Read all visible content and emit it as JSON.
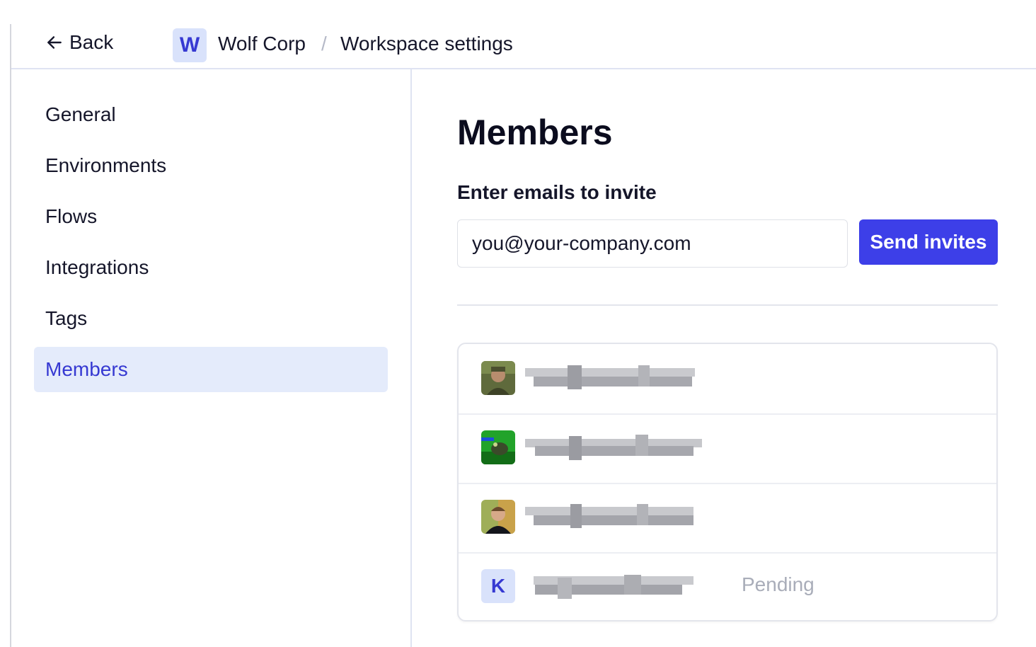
{
  "header": {
    "back_label": "Back",
    "workspace_initial": "W",
    "workspace_name": "Wolf Corp",
    "separator": "/",
    "page_name": "Workspace settings"
  },
  "sidebar": {
    "items": [
      {
        "label": "General"
      },
      {
        "label": "Environments"
      },
      {
        "label": "Flows"
      },
      {
        "label": "Integrations"
      },
      {
        "label": "Tags"
      },
      {
        "label": "Members",
        "active": true
      }
    ]
  },
  "main": {
    "title": "Members",
    "invite_label": "Enter emails to invite",
    "email_value": "you@your-company.com",
    "send_button": "Send invites"
  },
  "members": [
    {
      "avatar": "photo-avatar"
    },
    {
      "avatar": "photo-avatar"
    },
    {
      "avatar": "photo-avatar"
    },
    {
      "avatar_initial": "K",
      "status": "Pending"
    }
  ],
  "colors": {
    "accent": "#3d3fe8",
    "active_bg": "#e4ebfb",
    "badge_bg": "#d9e2fb",
    "pending_text": "#a9adb9"
  }
}
